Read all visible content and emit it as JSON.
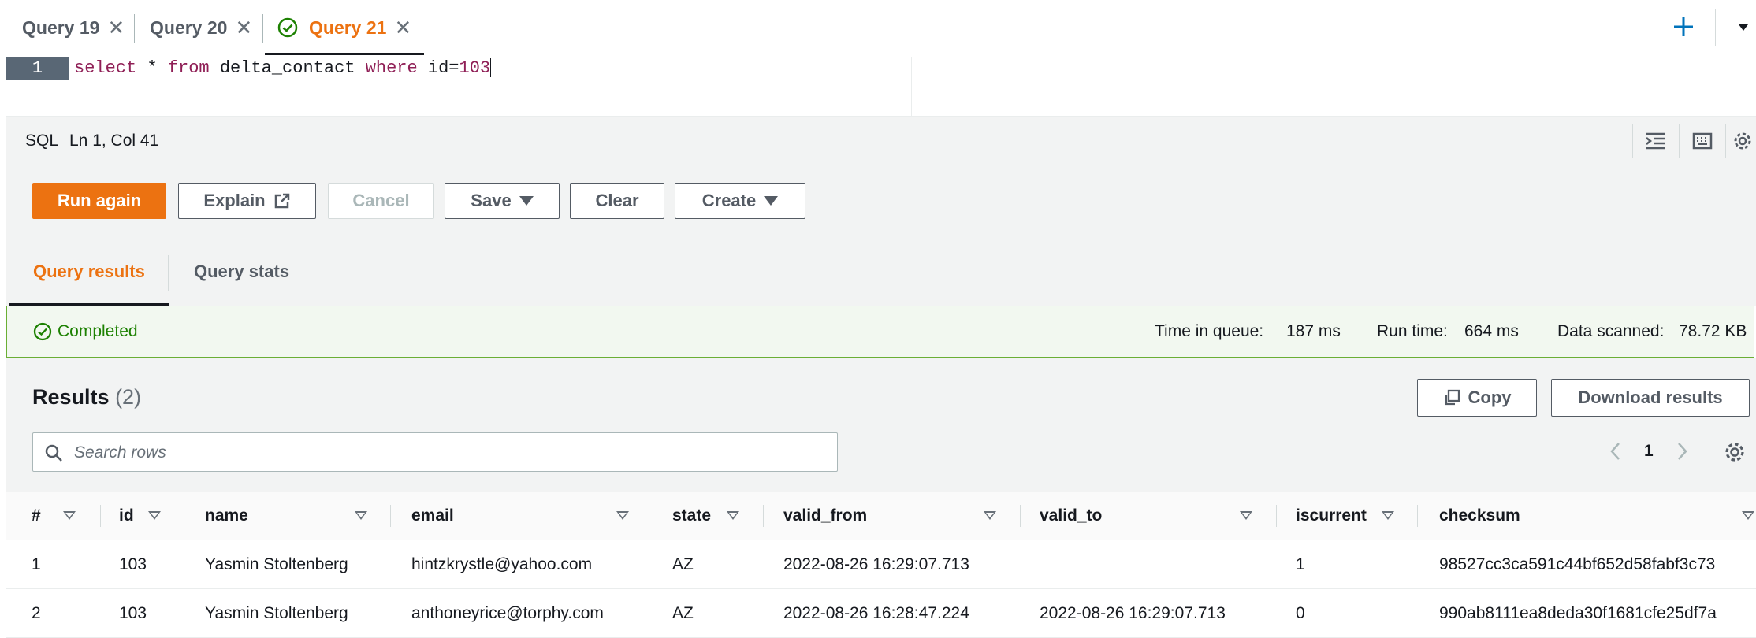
{
  "tabs": [
    {
      "label": "Query 19",
      "status": "none"
    },
    {
      "label": "Query 20",
      "status": "none"
    },
    {
      "label": "Query 21",
      "status": "success",
      "active": true
    }
  ],
  "tab_actions": {
    "add_icon": "plus-icon",
    "menu_icon": "caret-down-icon"
  },
  "editor": {
    "line_number": "1",
    "tokens": [
      {
        "text": "select",
        "type": "kw"
      },
      {
        "text": " * ",
        "type": "plain"
      },
      {
        "text": "from",
        "type": "kw"
      },
      {
        "text": " delta_contact ",
        "type": "plain"
      },
      {
        "text": "where",
        "type": "kw"
      },
      {
        "text": " id=",
        "type": "plain"
      },
      {
        "text": "103",
        "type": "num"
      }
    ]
  },
  "status_bar": {
    "language": "SQL",
    "cursor": "Ln 1, Col 41"
  },
  "toolbar": {
    "run_again": "Run again",
    "explain": "Explain",
    "cancel": "Cancel",
    "save": "Save",
    "clear": "Clear",
    "create": "Create"
  },
  "result_tabs": {
    "results": "Query results",
    "stats": "Query stats"
  },
  "banner": {
    "status": "Completed",
    "queue_label": "Time in queue:",
    "queue_value": "187 ms",
    "run_label": "Run time:",
    "run_value": "664 ms",
    "scanned_label": "Data scanned:",
    "scanned_value": "78.72 KB"
  },
  "results": {
    "title": "Results",
    "count": "(2)",
    "copy": "Copy",
    "download": "Download results",
    "search_placeholder": "Search rows",
    "page": "1"
  },
  "table": {
    "columns": [
      "#",
      "id",
      "name",
      "email",
      "state",
      "valid_from",
      "valid_to",
      "iscurrent",
      "checksum"
    ],
    "rows": [
      [
        "1",
        "103",
        "Yasmin Stoltenberg",
        "hintzkrystle@yahoo.com",
        "AZ",
        "2022-08-26 16:29:07.713",
        "",
        "1",
        "98527cc3ca591c44bf652d58fabf3c73"
      ],
      [
        "2",
        "103",
        "Yasmin Stoltenberg",
        "anthoneyrice@torphy.com",
        "AZ",
        "2022-08-26 16:28:47.224",
        "2022-08-26 16:29:07.713",
        "0",
        "990ab8111ea8deda30f1681cfe25df7a"
      ]
    ]
  },
  "colors": {
    "accent": "#ec7211",
    "success": "#1d8102",
    "success_border": "#6aaf35"
  }
}
